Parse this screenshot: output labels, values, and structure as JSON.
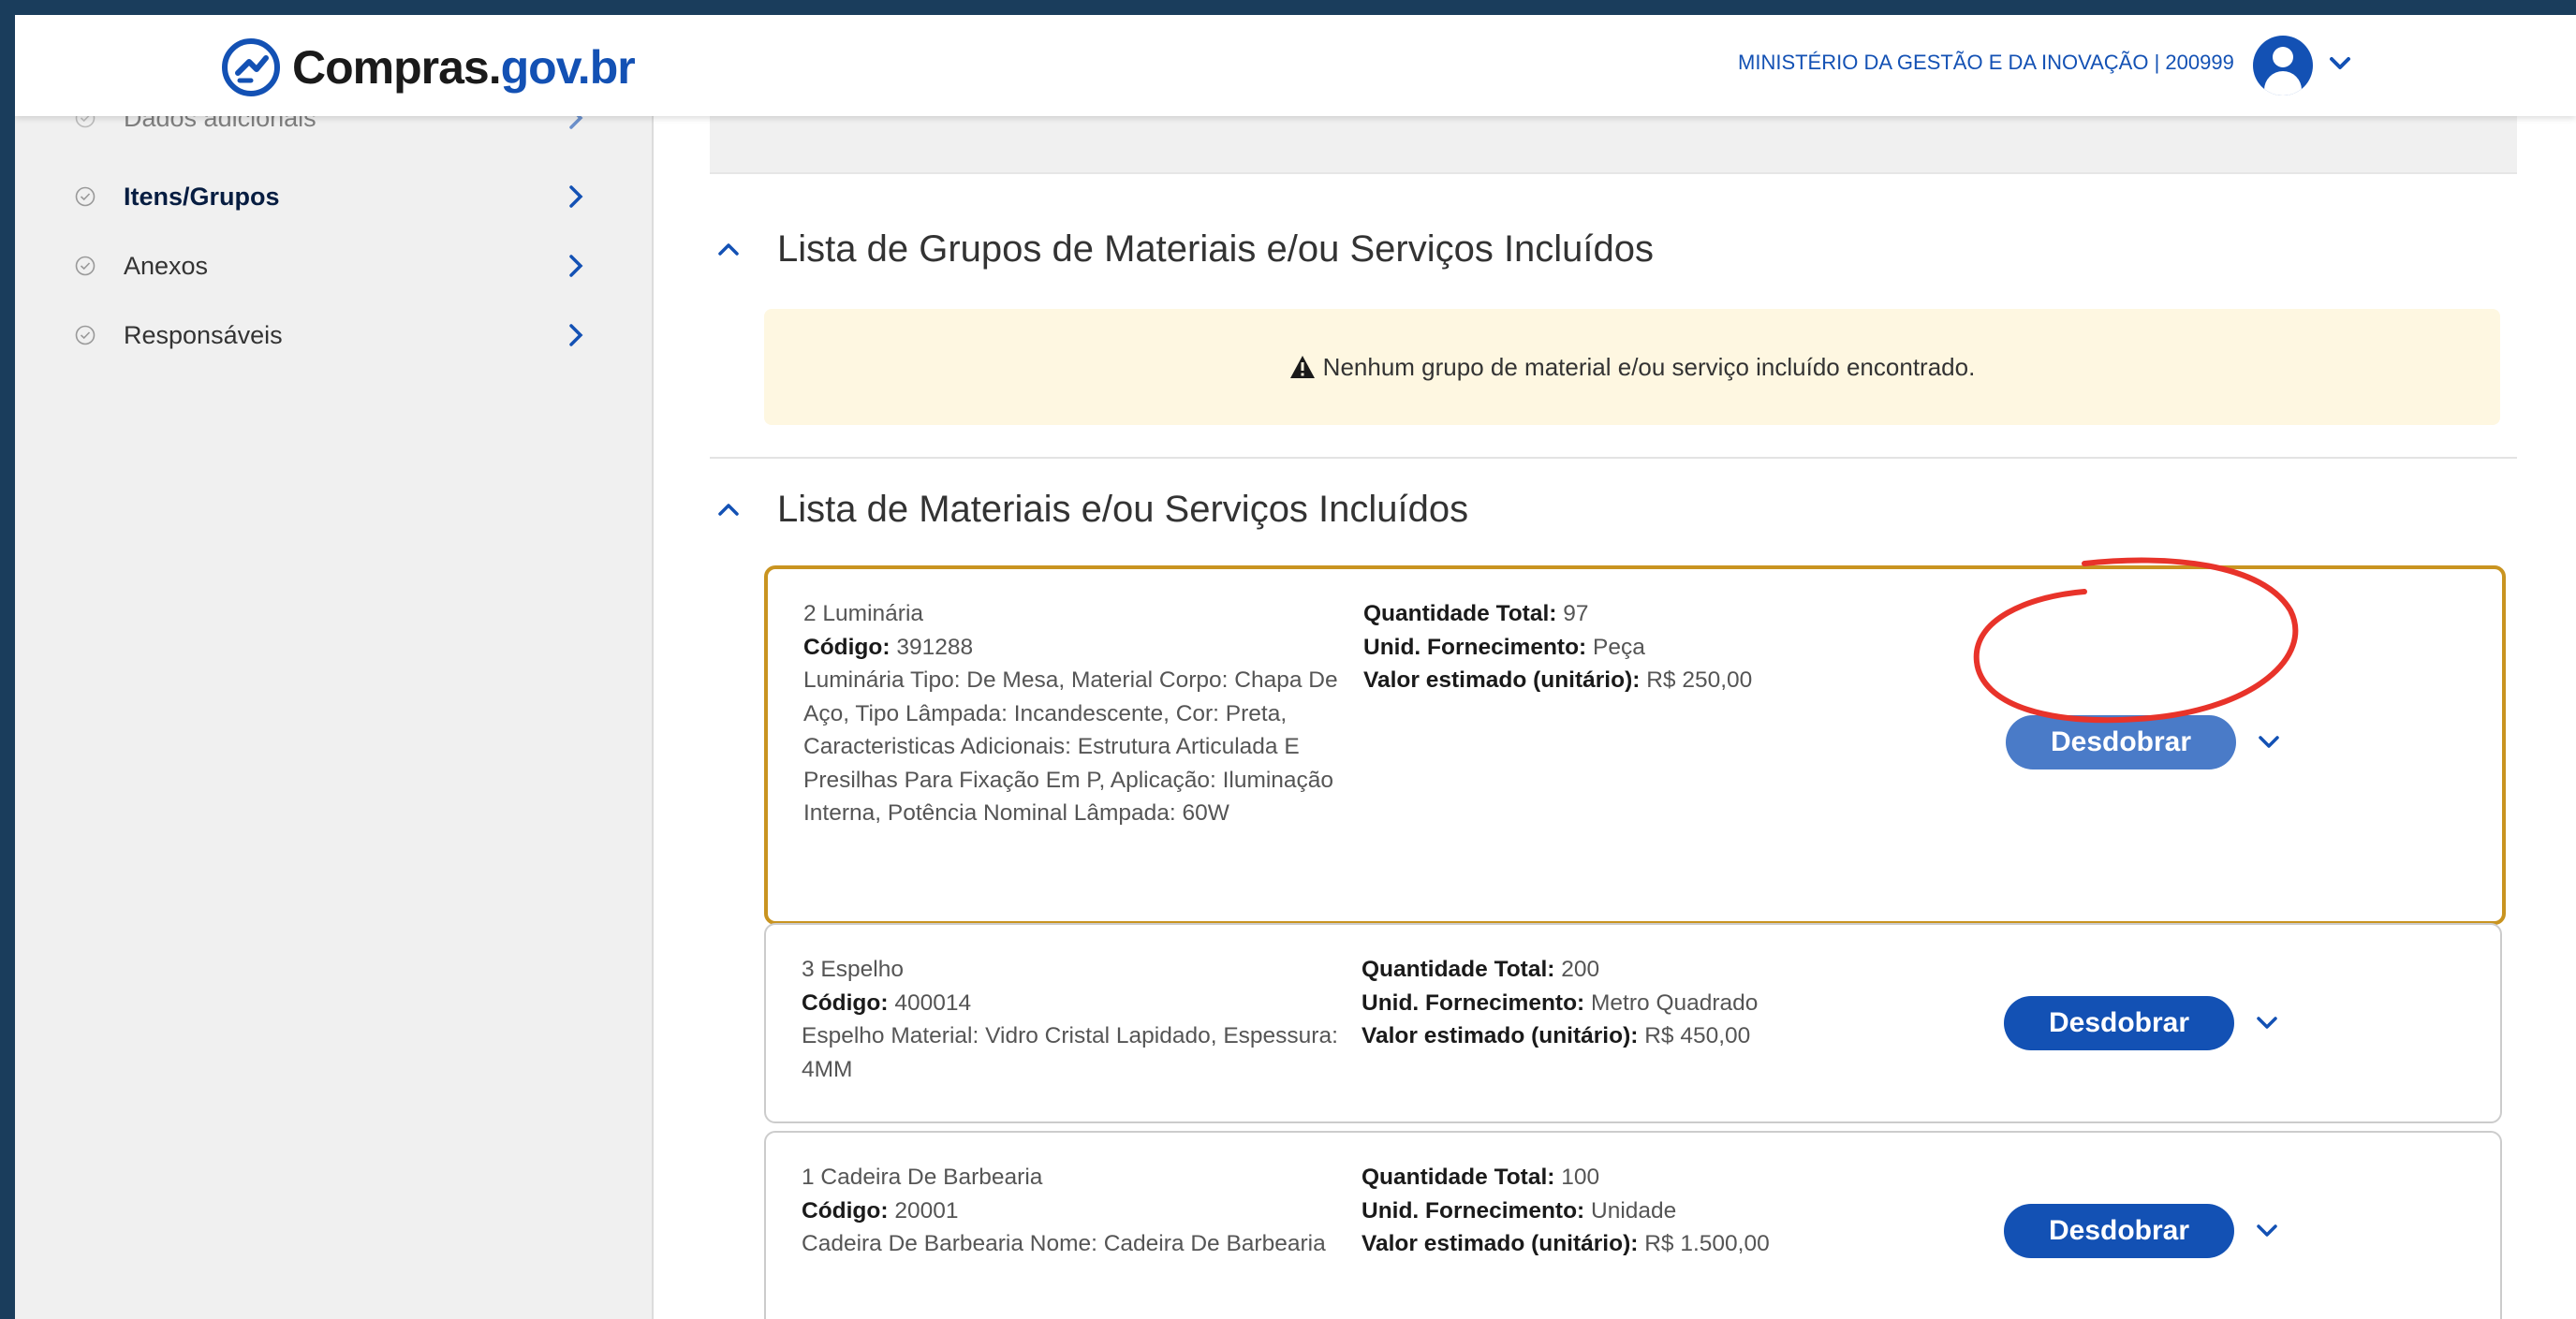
{
  "header": {
    "logo_text_main": "Compras.",
    "logo_text_gov": "gov.br",
    "org_label": "MINISTÉRIO DA GESTÃO E DA INOVAÇÃO | 200999",
    "avatar_icon": "user-circle-icon",
    "menu_icon": "chevron-down-icon",
    "brand_color": "#1351b4"
  },
  "sidebar": {
    "items": [
      {
        "label": "Dados adicionais",
        "active": false
      },
      {
        "label": "Itens/Grupos",
        "active": true
      },
      {
        "label": "Anexos",
        "active": false
      },
      {
        "label": "Responsáveis",
        "active": false
      }
    ]
  },
  "groups_section": {
    "title": "Lista de Grupos de Materiais e/ou Serviços Incluídos",
    "alert": "Nenhum grupo de material e/ou serviço incluído encontrado.",
    "alert_icon": "warning-icon"
  },
  "items_section": {
    "title": "Lista de Materiais e/ou Serviços Incluídos",
    "labels": {
      "code": "Código:",
      "qty": "Quantidade Total:",
      "unit": "Unid. Fornecimento:",
      "value": "Valor estimado (unitário):"
    },
    "button_label": "Desdobrar",
    "items": [
      {
        "name": "2 Luminária",
        "code": " 391288",
        "description": "Luminária Tipo: De Mesa, Material Corpo: Chapa De Aço, Tipo Lâmpada: Incandescente, Cor: Preta, Caracteristicas Adicionais: Estrutura Articulada E Presilhas Para Fixação Em P, Aplicação: Iluminação Interna, Potência Nominal Lâmpada: 60W",
        "qty": " 97",
        "unit": " Peça",
        "value": " R$ 250,00",
        "selected": true
      },
      {
        "name": "3 Espelho",
        "code": " 400014",
        "description": "Espelho Material: Vidro Cristal Lapidado, Espessura: 4MM",
        "qty": " 200",
        "unit": " Metro Quadrado",
        "value": " R$ 450,00",
        "selected": false
      },
      {
        "name": "1 Cadeira De Barbearia",
        "code": " 20001",
        "description": "Cadeira De Barbearia Nome: Cadeira De Barbearia",
        "qty": " 100",
        "unit": " Unidade",
        "value": " R$ 1.500,00",
        "selected": false
      }
    ]
  },
  "colors": {
    "selected_border": "#c99420",
    "button": "#1351b4",
    "annotation": "#e8332a",
    "alert_bg": "#fef7e1"
  }
}
